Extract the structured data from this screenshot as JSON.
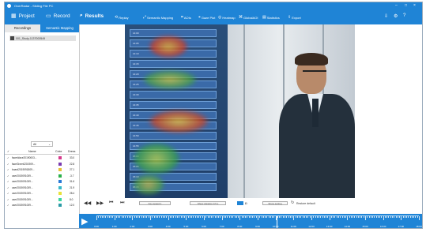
{
  "window": {
    "title": "OverRadar - Sliding File PC",
    "controls": [
      "–",
      "□",
      "×"
    ]
  },
  "nav": {
    "project_label": "Project",
    "record_label": "Record",
    "results_label": "Results",
    "tools": [
      {
        "icon": "replay-icon",
        "glyph": "⟲",
        "label": "Replay"
      },
      {
        "icon": "semantic-mapping-icon",
        "glyph": "⤢",
        "label": "Semantic Mapping"
      },
      {
        "icon": "aoi-icon",
        "glyph": "⌗",
        "label": "AOIs"
      },
      {
        "icon": "gaze-plot-icon",
        "glyph": "⌖",
        "label": "Gaze Plot"
      },
      {
        "icon": "heatmap-icon",
        "glyph": "◎",
        "label": "Heatmap"
      },
      {
        "icon": "globalaoi-icon",
        "glyph": "⌘",
        "label": "GlobalAOI"
      },
      {
        "icon": "statistics-icon",
        "glyph": "▤",
        "label": "Statistics"
      },
      {
        "icon": "export-icon",
        "glyph": "⇪",
        "label": "Export"
      }
    ],
    "right_icons": [
      "⇩",
      "⚙",
      "?"
    ]
  },
  "sidebar": {
    "tabs": [
      "Recordings",
      "Semantic Mapping"
    ],
    "recording_item": "001_Study-1137000549",
    "filter_value": "All",
    "columns": [
      "Name",
      "Color",
      "Dress"
    ],
    "rows": [
      {
        "check": "✓",
        "name": "faces\\face20190003...",
        "color": "#d63a8c",
        "value": "33.0"
      },
      {
        "check": "✓",
        "name": "faceGiven0201909...",
        "color": "#7a3ab0",
        "value": "22.8"
      },
      {
        "check": "✓",
        "name": "board2019091809...",
        "color": "#e8c23a",
        "value": "27.1"
      },
      {
        "check": "✓",
        "name": "user2019091009...",
        "color": "#2ab04a",
        "value": "-3.7"
      },
      {
        "check": "✓",
        "name": "user2019091009...",
        "color": "#2a7ad6",
        "value": "31.6"
      },
      {
        "check": "✓",
        "name": "user2019091009...",
        "color": "#38b8c8",
        "value": "21.9"
      },
      {
        "check": "✓",
        "name": "user2019091009...",
        "color": "#e8e23a",
        "value": "28.4"
      },
      {
        "check": "✓",
        "name": "user2019091009...",
        "color": "#3ad6a0",
        "value": "8.0"
      },
      {
        "check": "✓",
        "name": "user2019091009...",
        "color": "#2a9aa6",
        "value": "12.0"
      }
    ]
  },
  "video": {
    "board_rows": [
      "14:00",
      "14:05",
      "14:10",
      "14:15",
      "14:20",
      "14:25",
      "14:30",
      "14:35",
      "14:40",
      "14:45",
      "14:50",
      "14:55",
      "15:00",
      "15:05",
      "15:10",
      "15:15"
    ]
  },
  "controls": {
    "buttons": [
      "◀◀",
      "▶▶",
      "⏮",
      "⏭"
    ],
    "field1": "Key speed 1",
    "field2": "Show duration 0.5 s",
    "field3": "Show setting",
    "reset_label": "Restore default"
  },
  "timeline": {
    "labels": [
      "0:00",
      "1:00",
      "2:00",
      "3:00",
      "4:00",
      "5:00",
      "6:00",
      "7:00",
      "8:00",
      "9:00",
      "10:00",
      "11:00",
      "12:00",
      "13:00",
      "14:00",
      "15:00",
      "16:00",
      "17:00",
      "18:00"
    ],
    "progress": 0.56
  }
}
